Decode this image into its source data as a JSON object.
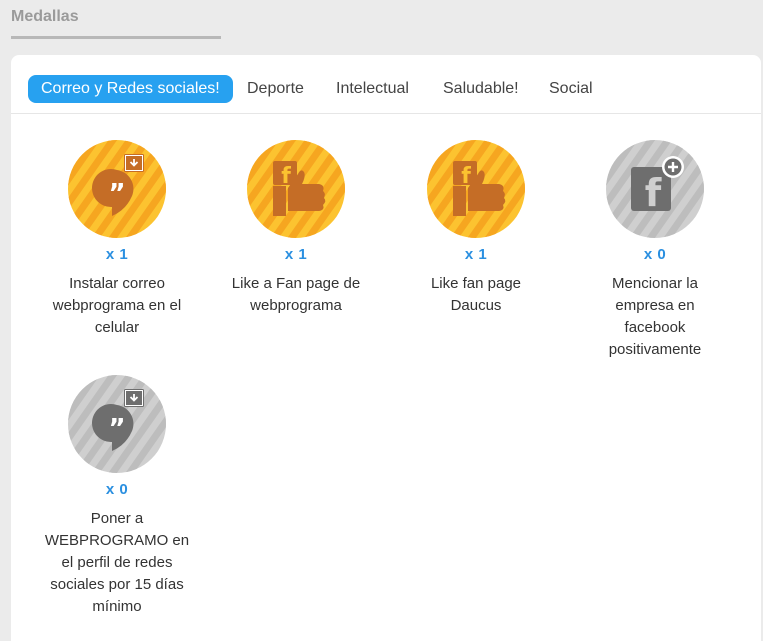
{
  "section": {
    "title": "Medallas"
  },
  "tabs": [
    {
      "label": "Correo y Redes sociales!",
      "active": true
    },
    {
      "label": "Deporte",
      "active": false
    },
    {
      "label": "Intelectual",
      "active": false
    },
    {
      "label": "Saludable!",
      "active": false
    },
    {
      "label": "Social",
      "active": false
    }
  ],
  "medals": [
    {
      "icon": "hangouts-download-icon",
      "earned": true,
      "count": "x 1",
      "label": "Instalar correo webprograma en el celular"
    },
    {
      "icon": "facebook-like-icon",
      "earned": true,
      "count": "x 1",
      "label": "Like a Fan page de webprograma"
    },
    {
      "icon": "facebook-like-icon",
      "earned": true,
      "count": "x 1",
      "label": "Like fan page Daucus"
    },
    {
      "icon": "facebook-plus-icon",
      "earned": false,
      "count": "x 0",
      "label": "Mencionar la empresa en facebook positivamente"
    },
    {
      "icon": "hangouts-download-icon",
      "earned": false,
      "count": "x 0",
      "label": "Poner a WEBPROGRAMO en el perfil de redes sociales por 15 días mínimo"
    }
  ],
  "colors": {
    "accent": "#27a1f0",
    "count_text": "#2a8fe0",
    "earned_light": "#fcc330",
    "earned_dark": "#f6a620",
    "earned_glyph": "#c56d26",
    "locked_light": "#cfcfcf",
    "locked_dark": "#bdbdbd",
    "locked_glyph": "#6e6e6e"
  }
}
